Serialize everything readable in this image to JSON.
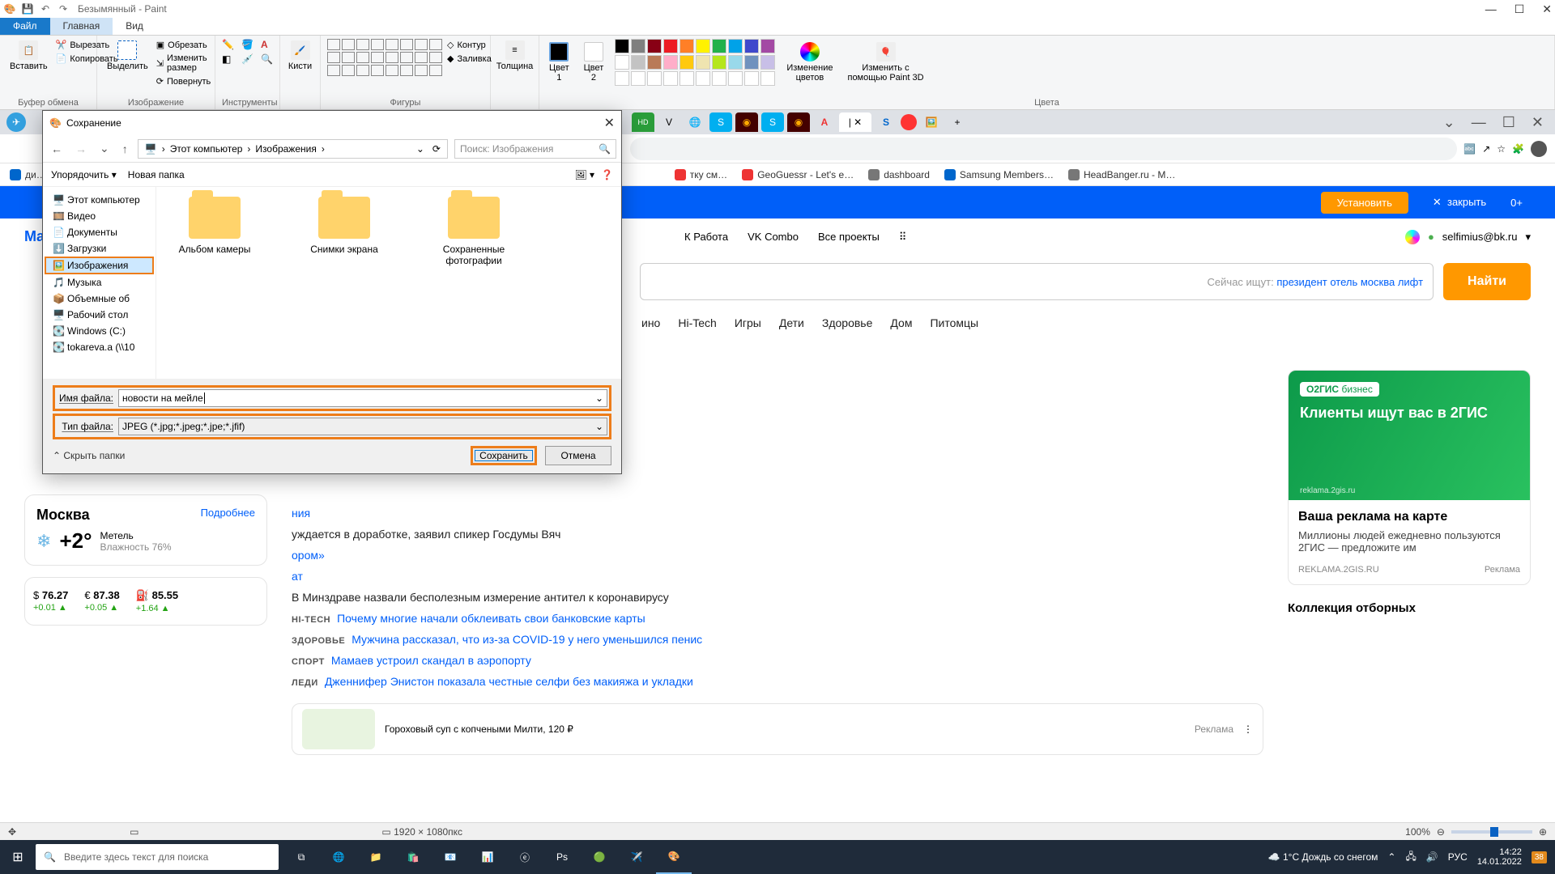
{
  "paint": {
    "title": "Безымянный - Paint",
    "tabs": {
      "file": "Файл",
      "home": "Главная",
      "view": "Вид"
    },
    "groups": {
      "clipboard": {
        "label": "Буфер обмена",
        "paste": "Вставить",
        "cut": "Вырезать",
        "copy": "Копировать"
      },
      "image": {
        "label": "Изображение",
        "select": "Выделить",
        "crop": "Обрезать",
        "resize": "Изменить размер",
        "rotate": "Повернуть"
      },
      "tools": {
        "label": "Инструменты"
      },
      "brushes": {
        "label": "Кисти",
        "btn": "Кисти"
      },
      "shapes": {
        "label": "Фигуры",
        "outline": "Контур",
        "fill": "Заливка"
      },
      "thickness": {
        "label": "Толщина"
      },
      "colors": {
        "label": "Цвета",
        "c1": "Цвет\n1",
        "c2": "Цвет\n2",
        "edit": "Изменение\nцветов",
        "paint3d": "Изменить с\nпомощью Paint 3D"
      }
    },
    "status": {
      "dims": "1920 × 1080пкс",
      "zoom": "100%"
    },
    "palette": [
      "#000000",
      "#7f7f7f",
      "#880015",
      "#ed1c24",
      "#ff7f27",
      "#fff200",
      "#22b14c",
      "#00a2e8",
      "#3f48cc",
      "#a349a4",
      "#ffffff",
      "#c3c3c3",
      "#b97a57",
      "#ffaec9",
      "#ffc90e",
      "#efe4b0",
      "#b5e61d",
      "#99d9ea",
      "#7092be",
      "#c8bfe7",
      "#ffffff",
      "#ffffff",
      "#ffffff",
      "#ffffff",
      "#ffffff",
      "#ffffff",
      "#ffffff",
      "#ffffff",
      "#ffffff",
      "#ffffff"
    ]
  },
  "save_dialog": {
    "title": "Сохранение",
    "breadcrumb": [
      "Этот компьютер",
      "Изображения"
    ],
    "search_placeholder": "Поиск: Изображения",
    "organize": "Упорядочить",
    "new_folder": "Новая папка",
    "tree": [
      "Этот компьютер",
      "Видео",
      "Документы",
      "Загрузки",
      "Изображения",
      "Музыка",
      "Объемные об",
      "Рабочий стол",
      "Windows (C:)",
      "tokareva.a (\\\\10"
    ],
    "tree_selected_index": 4,
    "files": [
      "Альбом камеры",
      "Снимки экрана",
      "Сохраненные фотографии"
    ],
    "filename_label": "Имя файла:",
    "filetype_label": "Тип файла:",
    "filename": "новости на мейле",
    "filetype": "JPEG (*.jpg;*.jpeg;*.jpe;*.jfif)",
    "hide_folders": "Скрыть папки",
    "save_btn": "Сохранить",
    "cancel_btn": "Отмена"
  },
  "browser": {
    "bookmarks": [
      "ди…",
      "тку см…",
      "GeoGuessr - Let's e…",
      "dashboard",
      "Samsung Members…",
      "HeadBanger.ru - М…"
    ],
    "banner": {
      "install": "Установить",
      "close": "закрыть",
      "count": "0+"
    }
  },
  "mail": {
    "brand": "Mail.r",
    "topnav": [
      "К Работа",
      "VK Combo",
      "Все проекты"
    ],
    "user_email": "selfimius@bk.ru",
    "search": {
      "hint_label": "Сейчас ищут:",
      "hint_link": "президент отель москва лифт",
      "find": "Найти"
    },
    "nav": [
      "ино",
      "Hi-Tech",
      "Игры",
      "Дети",
      "Здоровье",
      "Дом",
      "Питомцы"
    ],
    "weather": {
      "city": "Москва",
      "more": "Подробнее",
      "temp": "+2°",
      "cond": "Метель",
      "humid": "Влажность 76%"
    },
    "stocks": [
      {
        "sym": "$",
        "val": "76.27",
        "delta": "+0.01 ▲"
      },
      {
        "sym": "€",
        "val": "87.38",
        "delta": "+0.05 ▲"
      },
      {
        "sym": "⛽",
        "val": "85.55",
        "delta": "+1.64 ▲"
      }
    ],
    "news": [
      {
        "cat": "",
        "text_plain_before": "",
        "link": "ния",
        "text_plain_after": ""
      },
      {
        "cat": "",
        "text_plain_before": "уждается в доработке, заявил спикер Госдумы Вяч",
        "link": "",
        "text_plain_after": ""
      },
      {
        "cat": "",
        "text_plain_before": "",
        "link": "ором»",
        "text_plain_after": ""
      },
      {
        "cat": "",
        "text_plain_before": "",
        "link": "ат",
        "text_plain_after": ""
      },
      {
        "cat": "",
        "text_plain_before": "В Минздраве назвали бесполезным измерение антител к коронавирусу",
        "link": "",
        "text_plain_after": ""
      },
      {
        "cat": "HI-TECH",
        "link": "Почему многие начали обклеивать свои банковские карты"
      },
      {
        "cat": "ЗДОРОВЬЕ",
        "link": "Мужчина рассказал, что из-за COVID-19 у него уменьшился пенис"
      },
      {
        "cat": "СПОРТ",
        "link": "Мамаев устроил скандал в аэропорту"
      },
      {
        "cat": "ЛЕДИ",
        "link": "Дженнифер Энистон показала честные селфи без макияжа и укладки"
      }
    ],
    "recipe": {
      "title": "Гороховый суп с копчеными Милти, 120 ₽",
      "ad": "Реклама"
    },
    "ad": {
      "badge1": "О2ГИС",
      "badge2": "бизнес",
      "slogan": "Клиенты ищут вас в 2ГИС",
      "disclaim": "reklama.2gis.ru",
      "title": "Ваша реклама на карте",
      "desc": "Миллионы людей ежедневно пользуются 2ГИС — предложите им",
      "foot_left": "REKLAMA.2GIS.RU",
      "foot_right": "Реклама"
    },
    "collection": "Коллекция отборных"
  },
  "taskbar": {
    "search_placeholder": "Введите здесь текст для поиска",
    "weather": "1°C Дождь со снегом",
    "lang": "РУС",
    "time": "14:22",
    "date": "14.01.2022",
    "notif": "38"
  }
}
